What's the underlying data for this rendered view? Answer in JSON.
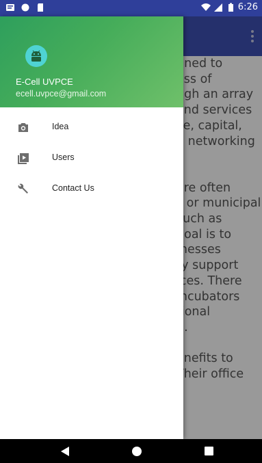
{
  "status_bar": {
    "time": "6:26",
    "icons": [
      "notification-icon",
      "circle-icon",
      "sdcard-icon",
      "wifi-icon",
      "signal-icon",
      "battery-icon"
    ]
  },
  "app_bar": {
    "menu_icon": "more-vert-icon"
  },
  "content": {
    "lines": [
      "gned to",
      "ess of",
      "ugh an array",
      "and services",
      "ce, capital,",
      "d networking",
      "",
      "",
      "are often",
      "s or municipal",
      "such as",
      "goal is to",
      "inesses",
      "ry support",
      "ices. There",
      " incubators",
      "tional",
      "n.",
      "",
      "enefits to",
      "Their office"
    ]
  },
  "drawer": {
    "header": {
      "name": "E-Cell UVPCE",
      "email": "ecell.uvpce@gmail.com",
      "avatar_icon": "android-icon",
      "colors": {
        "start": "#2e9f5c",
        "end": "#6fc06a"
      }
    },
    "items": [
      {
        "label": "Idea",
        "icon": "camera-icon"
      },
      {
        "label": "Users",
        "icon": "video-library-icon"
      },
      {
        "label": "Contact Us",
        "icon": "wrench-icon"
      }
    ]
  },
  "colors": {
    "primary": "#3f51b5",
    "status_bar": "#2f3f9a",
    "accent_green": "#46ad5a"
  },
  "nav_bar": {
    "buttons": [
      "back-icon",
      "home-icon",
      "recents-icon"
    ]
  }
}
